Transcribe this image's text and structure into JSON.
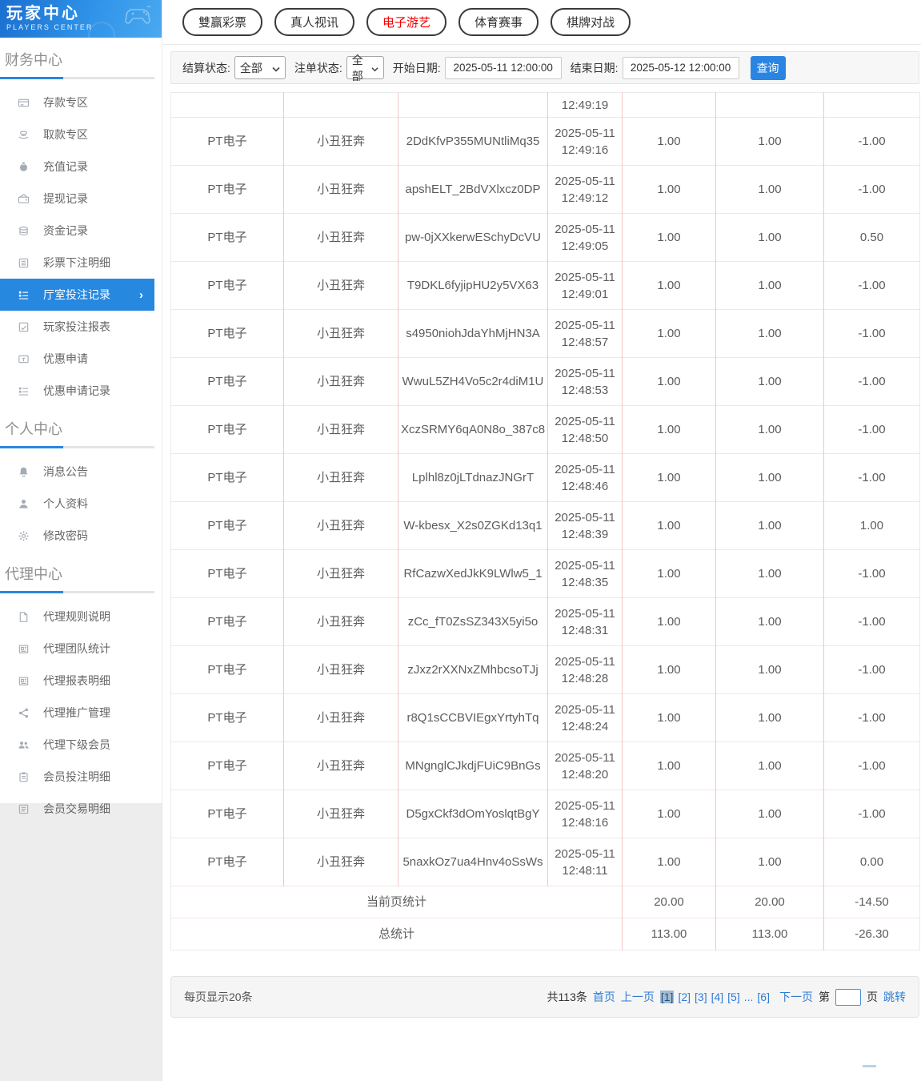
{
  "brand": {
    "title": "玩家中心",
    "subtitle": "PLAYERS CENTER"
  },
  "top_nav": [
    {
      "label": "雙赢彩票",
      "active": false
    },
    {
      "label": "真人视讯",
      "active": false
    },
    {
      "label": "电子游艺",
      "active": true
    },
    {
      "label": "体育赛事",
      "active": false
    },
    {
      "label": "棋牌对战",
      "active": false
    }
  ],
  "sidebar": {
    "sections": [
      {
        "title": "财务中心",
        "items": [
          {
            "label": "存款专区",
            "icon": "card-icon"
          },
          {
            "label": "取款专区",
            "icon": "hand-coin-icon"
          },
          {
            "label": "充值记录",
            "icon": "money-bag-icon"
          },
          {
            "label": "提现记录",
            "icon": "wallet-icon"
          },
          {
            "label": "资金记录",
            "icon": "coins-icon"
          },
          {
            "label": "彩票下注明细",
            "icon": "doc-lines-icon"
          },
          {
            "label": "厅室投注记录",
            "icon": "list-icon",
            "active": true
          },
          {
            "label": "玩家投注报表",
            "icon": "report-icon"
          },
          {
            "label": "优惠申请",
            "icon": "ticket-icon"
          },
          {
            "label": "优惠申请记录",
            "icon": "list-detail-icon"
          }
        ]
      },
      {
        "title": "个人中心",
        "items": [
          {
            "label": "消息公告",
            "icon": "bell-icon"
          },
          {
            "label": "个人资料",
            "icon": "person-icon"
          },
          {
            "label": "修改密码",
            "icon": "gear-icon"
          }
        ]
      },
      {
        "title": "代理中心",
        "items": [
          {
            "label": "代理规则说明",
            "icon": "doc-blank-icon"
          },
          {
            "label": "代理团队统计",
            "icon": "news-icon"
          },
          {
            "label": "代理报表明细",
            "icon": "news-icon"
          },
          {
            "label": "代理推广管理",
            "icon": "share-icon"
          },
          {
            "label": "代理下级会员",
            "icon": "users-icon"
          },
          {
            "label": "会员投注明细",
            "icon": "clipboard-icon"
          },
          {
            "label": "会员交易明细",
            "icon": "box-list-icon"
          }
        ]
      }
    ]
  },
  "filters": {
    "settle_status": {
      "label": "结算状态:",
      "value": "全部"
    },
    "order_status": {
      "label": "注单状态:",
      "value": "全部"
    },
    "start_date": {
      "label": "开始日期:",
      "value": "2025-05-11 12:00:00"
    },
    "end_date": {
      "label": "结束日期:",
      "value": "2025-05-12 12:00:00"
    },
    "search_label": "查询"
  },
  "table": {
    "partial_row": {
      "time": "12:49:19"
    },
    "rows": [
      {
        "venue": "PT电子",
        "game": "小丑狂奔",
        "order_id": "2DdKfvP355MUNtliMq35",
        "date": "2025-05-11",
        "time": "12:49:16",
        "bet": "1.00",
        "valid": "1.00",
        "winloss": "-1.00"
      },
      {
        "venue": "PT电子",
        "game": "小丑狂奔",
        "order_id": "apshELT_2BdVXlxcz0DP",
        "date": "2025-05-11",
        "time": "12:49:12",
        "bet": "1.00",
        "valid": "1.00",
        "winloss": "-1.00"
      },
      {
        "venue": "PT电子",
        "game": "小丑狂奔",
        "order_id": "pw-0jXXkerwESchyDcVU",
        "date": "2025-05-11",
        "time": "12:49:05",
        "bet": "1.00",
        "valid": "1.00",
        "winloss": "0.50"
      },
      {
        "venue": "PT电子",
        "game": "小丑狂奔",
        "order_id": "T9DKL6fyjipHU2y5VX63",
        "date": "2025-05-11",
        "time": "12:49:01",
        "bet": "1.00",
        "valid": "1.00",
        "winloss": "-1.00"
      },
      {
        "venue": "PT电子",
        "game": "小丑狂奔",
        "order_id": "s4950niohJdaYhMjHN3A",
        "date": "2025-05-11",
        "time": "12:48:57",
        "bet": "1.00",
        "valid": "1.00",
        "winloss": "-1.00"
      },
      {
        "venue": "PT电子",
        "game": "小丑狂奔",
        "order_id": "WwuL5ZH4Vo5c2r4diM1U",
        "date": "2025-05-11",
        "time": "12:48:53",
        "bet": "1.00",
        "valid": "1.00",
        "winloss": "-1.00"
      },
      {
        "venue": "PT电子",
        "game": "小丑狂奔",
        "order_id": "XczSRMY6qA0N8o_387c8",
        "date": "2025-05-11",
        "time": "12:48:50",
        "bet": "1.00",
        "valid": "1.00",
        "winloss": "-1.00"
      },
      {
        "venue": "PT电子",
        "game": "小丑狂奔",
        "order_id": "Lplhl8z0jLTdnazJNGrT",
        "date": "2025-05-11",
        "time": "12:48:46",
        "bet": "1.00",
        "valid": "1.00",
        "winloss": "-1.00"
      },
      {
        "venue": "PT电子",
        "game": "小丑狂奔",
        "order_id": "W-kbesx_X2s0ZGKd13q1",
        "date": "2025-05-11",
        "time": "12:48:39",
        "bet": "1.00",
        "valid": "1.00",
        "winloss": "1.00"
      },
      {
        "venue": "PT电子",
        "game": "小丑狂奔",
        "order_id": "RfCazwXedJkK9LWlw5_1",
        "date": "2025-05-11",
        "time": "12:48:35",
        "bet": "1.00",
        "valid": "1.00",
        "winloss": "-1.00"
      },
      {
        "venue": "PT电子",
        "game": "小丑狂奔",
        "order_id": "zCc_fT0ZsSZ343X5yi5o",
        "date": "2025-05-11",
        "time": "12:48:31",
        "bet": "1.00",
        "valid": "1.00",
        "winloss": "-1.00"
      },
      {
        "venue": "PT电子",
        "game": "小丑狂奔",
        "order_id": "zJxz2rXXNxZMhbcsoTJj",
        "date": "2025-05-11",
        "time": "12:48:28",
        "bet": "1.00",
        "valid": "1.00",
        "winloss": "-1.00"
      },
      {
        "venue": "PT电子",
        "game": "小丑狂奔",
        "order_id": "r8Q1sCCBVIEgxYrtyhTq",
        "date": "2025-05-11",
        "time": "12:48:24",
        "bet": "1.00",
        "valid": "1.00",
        "winloss": "-1.00"
      },
      {
        "venue": "PT电子",
        "game": "小丑狂奔",
        "order_id": "MNgnglCJkdjFUiC9BnGs",
        "date": "2025-05-11",
        "time": "12:48:20",
        "bet": "1.00",
        "valid": "1.00",
        "winloss": "-1.00"
      },
      {
        "venue": "PT电子",
        "game": "小丑狂奔",
        "order_id": "D5gxCkf3dOmYoslqtBgY",
        "date": "2025-05-11",
        "time": "12:48:16",
        "bet": "1.00",
        "valid": "1.00",
        "winloss": "-1.00"
      },
      {
        "venue": "PT电子",
        "game": "小丑狂奔",
        "order_id": "5naxkOz7ua4Hnv4oSsWs",
        "date": "2025-05-11",
        "time": "12:48:11",
        "bet": "1.00",
        "valid": "1.00",
        "winloss": "0.00"
      }
    ],
    "page_summary": {
      "label": "当前页统计",
      "bet_total": "20.00",
      "valid_total": "20.00",
      "winloss_total": "-14.50"
    },
    "grand_summary": {
      "label": "总统计",
      "bet_total": "113.00",
      "valid_total": "113.00",
      "winloss_total": "-26.30"
    }
  },
  "pagination": {
    "per_page": "每页显示20条",
    "total": "共113条",
    "first": "首页",
    "prev": "上一页",
    "pages": [
      {
        "label": "[1]",
        "current": true
      },
      {
        "label": "[2]",
        "current": false
      },
      {
        "label": "[3]",
        "current": false
      },
      {
        "label": "[4]",
        "current": false
      },
      {
        "label": "[5]",
        "current": false
      },
      {
        "label": "...",
        "current": false
      },
      {
        "label": "[6]",
        "current": false
      }
    ],
    "next": "下一页",
    "jump_prefix": "第",
    "jump_suffix": "页",
    "jump_label": "跳转",
    "jump_value": ""
  },
  "colors": {
    "accent": "#2788e0",
    "link": "#2f7cd4",
    "active_nav_text": "#f20000",
    "active_page_bg": "#a4bace"
  }
}
